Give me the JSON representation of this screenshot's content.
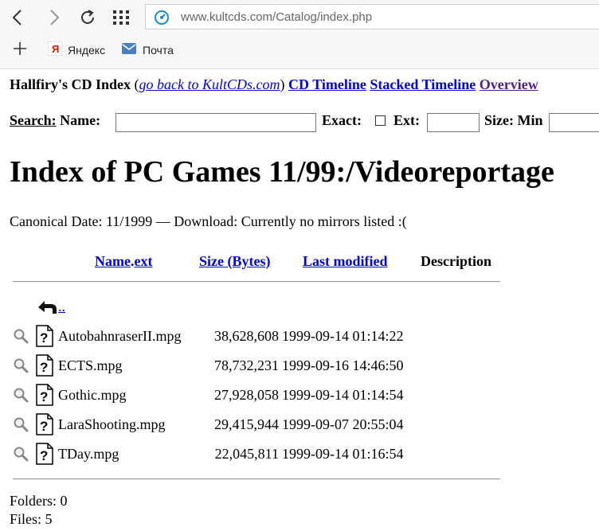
{
  "browser": {
    "url": "www.kultcds.com/Catalog/index.php",
    "bookmarks": [
      {
        "label": "Яндекс",
        "icon": "yandex-icon"
      },
      {
        "label": "Почта",
        "icon": "mail-icon"
      }
    ]
  },
  "nav": {
    "site_title": "Hallfiry's CD Index",
    "open_paren": "(",
    "back_link": "go back to KultCDs.com",
    "close_paren": ")",
    "timeline": "CD Timeline",
    "stacked": "Stacked Timeline",
    "overview": "Overview"
  },
  "search": {
    "label": "Search:",
    "name_label": "Name:",
    "exact_label": "Exact:",
    "ext_label": "Ext:",
    "size_label": "Size: Min"
  },
  "title": "Index of PC Games 11/99:/Videoreportage",
  "canonical": "Canonical Date: 11/1999 — Download: Currently no mirrors listed :(",
  "table": {
    "headers": {
      "name": "Name",
      "ext": "ext",
      "size": "Size (Bytes)",
      "modified": "Last modified",
      "description": "Description"
    },
    "parent": "..",
    "rows": [
      {
        "name": "AutobahnraserII.mpg",
        "size": "38,628,608",
        "modified": "1999-09-14 01:14:22"
      },
      {
        "name": "ECTS.mpg",
        "size": "78,732,231",
        "modified": "1999-09-16 14:46:50"
      },
      {
        "name": "Gothic.mpg",
        "size": "27,928,058",
        "modified": "1999-09-14 01:14:54"
      },
      {
        "name": "LaraShooting.mpg",
        "size": "29,415,944",
        "modified": "1999-09-07 20:55:04"
      },
      {
        "name": "TDay.mpg",
        "size": "22,045,811",
        "modified": "1999-09-14 01:16:54"
      }
    ]
  },
  "footer": {
    "folders": "Folders: 0",
    "files": "Files: 5"
  }
}
